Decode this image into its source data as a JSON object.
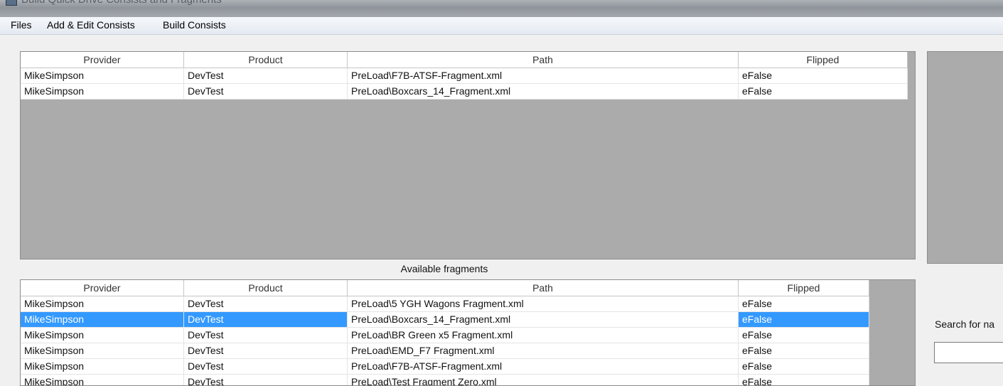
{
  "window": {
    "title": "Build Quick Drive Consists and Fragments"
  },
  "menu": [
    "Files",
    "Add & Edit Consists",
    "Build Consists"
  ],
  "columns": [
    "Provider",
    "Product",
    "Path",
    "Flipped"
  ],
  "consist_grid": {
    "rows": [
      [
        "MikeSimpson",
        "DevTest",
        "PreLoad\\F7B-ATSF-Fragment.xml",
        "eFalse"
      ],
      [
        "MikeSimpson",
        "DevTest",
        "PreLoad\\Boxcars_14_Fragment.xml",
        "eFalse"
      ]
    ]
  },
  "available": {
    "label": "Available fragments",
    "selected_index": 1,
    "rows": [
      [
        "MikeSimpson",
        "DevTest",
        "PreLoad\\5 YGH Wagons Fragment.xml",
        "eFalse"
      ],
      [
        "MikeSimpson",
        "DevTest",
        "PreLoad\\Boxcars_14_Fragment.xml",
        "eFalse"
      ],
      [
        "MikeSimpson",
        "DevTest",
        "PreLoad\\BR Green x5 Fragment.xml",
        "eFalse"
      ],
      [
        "MikeSimpson",
        "DevTest",
        "PreLoad\\EMD_F7 Fragment.xml",
        "eFalse"
      ],
      [
        "MikeSimpson",
        "DevTest",
        "PreLoad\\F7B-ATSF-Fragment.xml",
        "eFalse"
      ],
      [
        "MikeSimpson",
        "DevTest",
        "PreLoad\\Test Fragment Zero.xml",
        "eFalse"
      ]
    ]
  },
  "search": {
    "label": "Search for na",
    "value": ""
  },
  "colors": {
    "selection": "#3399ff",
    "grid_background": "#ababab",
    "window_background": "#f0f0f0"
  }
}
